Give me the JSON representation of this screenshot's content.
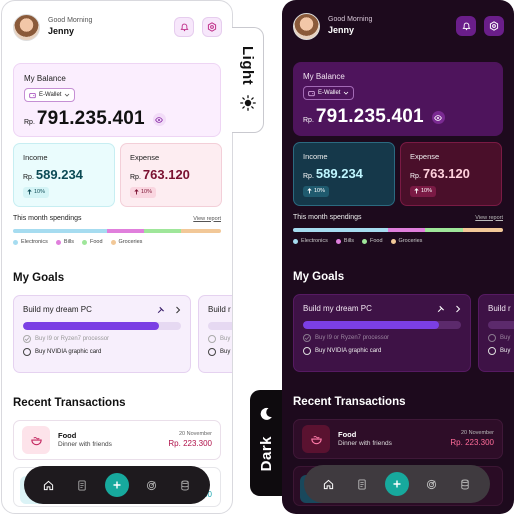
{
  "side_tabs": {
    "light_label": "Light",
    "dark_label": "Dark"
  },
  "header": {
    "greeting": "Good Morning",
    "user_name": "Jenny"
  },
  "balance": {
    "title": "My Balance",
    "wallet": "E-Wallet",
    "currency": "Rp.",
    "amount": "791.235.401"
  },
  "income": {
    "title": "Income",
    "currency": "Rp.",
    "amount": "589.234",
    "change": "10%"
  },
  "expense": {
    "title": "Expense",
    "currency": "Rp.",
    "amount": "763.120",
    "change": "10%"
  },
  "spendings": {
    "title": "This month spendings",
    "view_report": "View report",
    "categories": [
      {
        "label": "Electronics",
        "color": "#a6dcf0",
        "share": 0.45
      },
      {
        "label": "Bills",
        "color": "#e07fdc",
        "share": 0.18
      },
      {
        "label": "Food",
        "color": "#9fe69a",
        "share": 0.18
      },
      {
        "label": "Groceries",
        "color": "#f2c898",
        "share": 0.19
      }
    ]
  },
  "goals": {
    "title": "My Goals",
    "items": [
      {
        "name": "Build my dream PC",
        "progress": 0.86,
        "tasks": [
          {
            "label": "Buy I9 or Ryzen7 processor",
            "done": true
          },
          {
            "label": "Buy NVIDIA graphic card",
            "done": false
          }
        ]
      },
      {
        "name": "Build r",
        "tasks": [
          {
            "label": "Buy",
            "done": true
          },
          {
            "label": "Buy",
            "done": false
          }
        ]
      }
    ]
  },
  "transactions": {
    "title": "Recent Transactions",
    "items": [
      {
        "name": "Food",
        "desc": "Dinner with friends",
        "date": "20 November",
        "amount": "Rp. 223.300"
      }
    ],
    "partial_amount": "00"
  },
  "colors": {
    "accent": "#7b3fe4",
    "add_button": "#17a99d",
    "dark_bg": "#1d0a1d"
  }
}
